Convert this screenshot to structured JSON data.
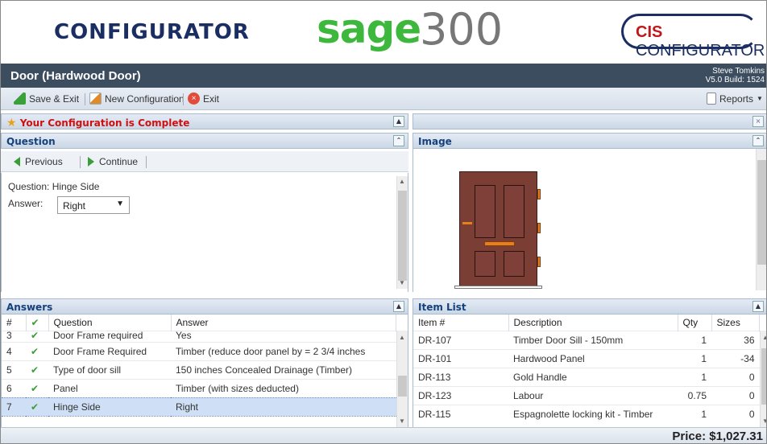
{
  "banner": {
    "brand_left": "CONFIGURATOR",
    "sage": "sage",
    "sage_number": "300",
    "cis_prefix": "CIS",
    "cis_suffix": "CONFIGURATOR"
  },
  "title": {
    "text": "Door (Hardwood Door)",
    "user": "Steve Tomkins",
    "version": "V5.0 Build: 1524"
  },
  "toolbar": {
    "save_exit": "Save & Exit",
    "new_configuration": "New Configuration",
    "exit": "Exit",
    "reports": "Reports"
  },
  "status": {
    "message": "Your Configuration is Complete"
  },
  "question_panel": {
    "title": "Question",
    "previous": "Previous",
    "continue": "Continue",
    "question_label": "Question:",
    "question_value": "Hinge Side",
    "answer_label": "Answer:",
    "answer_value": "Right"
  },
  "image_panel": {
    "title": "Image"
  },
  "answers_panel": {
    "title": "Answers",
    "columns": [
      "#",
      "Question",
      "Answer"
    ],
    "rows": [
      {
        "num": "3",
        "question": "Door Frame required",
        "answer": "Yes"
      },
      {
        "num": "4",
        "question": "Door Frame Required",
        "answer": "Timber (reduce door panel by = 2 3/4 inches"
      },
      {
        "num": "5",
        "question": "Type of door sill",
        "answer": "150 inches Concealed Drainage (Timber)"
      },
      {
        "num": "6",
        "question": "Panel",
        "answer": "Timber (with sizes deducted)"
      },
      {
        "num": "7",
        "question": "Hinge Side",
        "answer": "Right"
      }
    ]
  },
  "item_list_panel": {
    "title": "Item List",
    "columns": [
      "Item #",
      "Description",
      "Qty",
      "Sizes"
    ],
    "rows": [
      {
        "item": "DR-107",
        "description": "Timber Door Sill - 150mm",
        "qty": "1",
        "sizes": "36"
      },
      {
        "item": "DR-101",
        "description": "Hardwood Panel",
        "qty": "1",
        "sizes": "-34"
      },
      {
        "item": "DR-113",
        "description": "Gold Handle",
        "qty": "1",
        "sizes": "0"
      },
      {
        "item": "DR-123",
        "description": "Labour",
        "qty": "0.75",
        "sizes": "0"
      },
      {
        "item": "DR-115",
        "description": "Espagnolette locking kit - Timber",
        "qty": "1",
        "sizes": "0"
      }
    ]
  },
  "footer": {
    "price": "Price: $1,027.31"
  },
  "colors": {
    "title_bar": "#3b4d5e",
    "sage_green": "#3db83d",
    "brand_navy": "#1a2e63",
    "complete_red": "#d01010",
    "check_green": "#3a9d3a",
    "hinge_orange": "#e97f1c",
    "door_brown": "#7a3e35"
  }
}
